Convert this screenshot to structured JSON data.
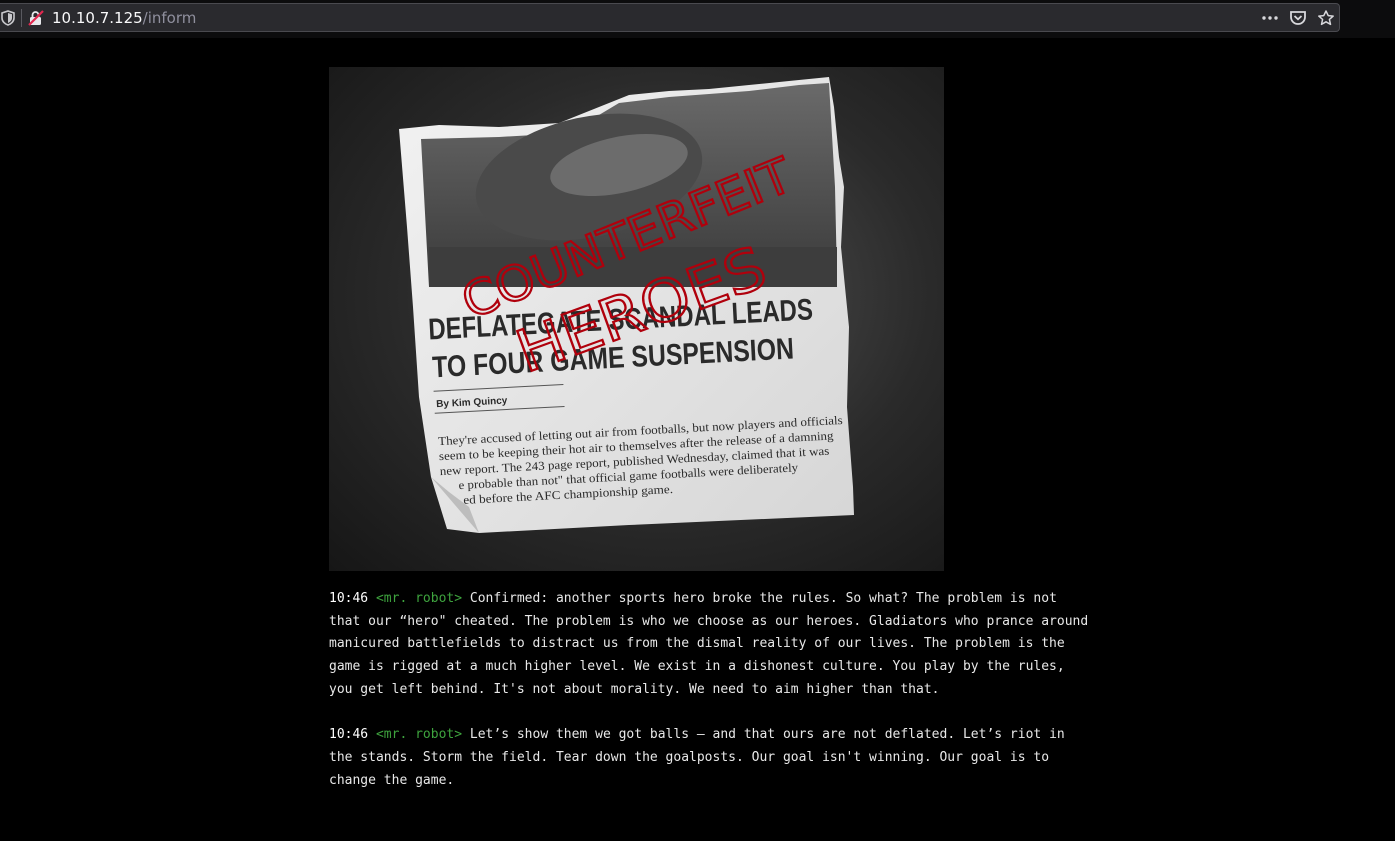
{
  "browser": {
    "url_host": "10.10.7.125",
    "url_path": "/inform",
    "icons": [
      "shield-icon",
      "insecure-lock-icon",
      "page-actions-icon",
      "pocket-icon",
      "bookmark-star-icon"
    ]
  },
  "hero_image": {
    "graffiti_line1": "COUNTERFEIT",
    "graffiti_line2": "HEROES",
    "headline_line1": "DEFLATEGATE SCANDAL LEADS",
    "headline_line2": "TO FOUR GAME SUSPENSION",
    "byline": "By Kim Quincy",
    "body_lines": [
      "They're accused of letting out air from footballs, but now players and officials",
      "seem to be keeping their hot air to themselves after the release of a damning",
      "new report. The 243 page report, published Wednesday, claimed that it was",
      "e probable than not\" that official game footballs were deliberately",
      "ed before the AFC championship game."
    ]
  },
  "messages": [
    {
      "time": "10:46",
      "nick": "<mr. robot>",
      "text": " Confirmed: another sports hero broke the rules. So what? The problem is not that our “hero\" cheated. The problem is who we choose as our heroes. Gladiators who prance around manicured battlefields to distract us from the dismal reality of our lives. The problem is the game is rigged at a much higher level. We exist in a dishonest culture. You play by the rules, you get left behind. It's not about morality. We need to aim higher than that."
    },
    {
      "time": "10:46",
      "nick": "<mr. robot>",
      "text": "Let’s show them  we got balls – and that ours are not deflated. Let’s riot in the stands.  Storm the field. Tear down the goalposts. Our goal isn't winning. Our goal is to change the game."
    }
  ],
  "colors": {
    "background": "#000000",
    "text": "#e8e8e8",
    "nick": "#3ea33e",
    "graffiti": "#b0000c"
  }
}
